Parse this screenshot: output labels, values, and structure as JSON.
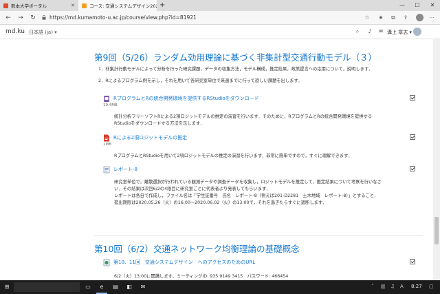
{
  "browser": {
    "tabs": [
      {
        "label": "熊本大学ポータル"
      },
      {
        "label": "コース: 交通システムデザイン2020 (..."
      }
    ],
    "new_tab": "+",
    "url": "https://md.kumamoto-u.ac.jp/course/view.php?id=81921"
  },
  "header": {
    "brand": "md.ku",
    "language": "日本語 (ja) ▾",
    "user_name": "溝上 章志 ▾"
  },
  "sections": [
    {
      "title": "第9回（5/26）ランダム効用理論に基づく非集計型交通行動モデル（３）",
      "summary": [
        "1．非集計行動モデルによって分析を行った研究課題，データの収集方法，モデル構成，推定結果，政策提言への応用について，説明します．",
        "2．Rによるプログラム例を示し，それを用いて各研究室単位で来週までに行って欲しい課題を出します．"
      ],
      "activities": [
        {
          "icon": "r-package-icon",
          "label": "RプログラムとRの統合開発環境を提供するRStudioをダウンロード",
          "size": "19.4MB",
          "desc": [
            "統計分析フリーソフトRによる2項ロジットモデルの推定の演習を行います．そのために，RプログラムとRの統合開発環境を提供する",
            "RStudioをダウンロードする方法を示します．"
          ]
        },
        {
          "icon": "pdf-icon",
          "label": "Rによる2項ロジットモデルの推定",
          "size": "1MB",
          "desc": [
            "RプログラムとRStudioを用いて2項ロジットモデルの推定の演習を行います．非常に簡単ですので，すぐに理解できます．"
          ]
        },
        {
          "icon": "assignment-icon",
          "label": "レポート-8",
          "size": "",
          "desc": [
            "研究室単位で，離散選択が行われている観測データや調査データを収集し，ロジットモデルを推定して，推定結果について考察を行いなさ",
            "い．その結果は次回6/2の4限目に研究室ごとに代表者より発表してもらいます．",
            "レポートは各自で作成し，ファイル名は「学生証番号　氏名　レポート-8（例えば201-D2281　土木地域　レポート-8）」とすること．",
            "提出期限は2020.05.26（火）の16:00～2020.06.02（火）の13:00で，それを過ぎたらすぐに遮断します．"
          ]
        }
      ]
    },
    {
      "title": "第10回（6/2）交通ネットワーク均衡理論の基礎概念",
      "summary": [],
      "activities": [
        {
          "icon": "url-icon",
          "label": "第10、11回　交通システムデザイン　へのアクセスのためのURL",
          "size": "",
          "desc": [
            "6/2（火）13:00に開講します．ミーティングID: 935 9149 3415　パスワード: 466454"
          ]
        }
      ]
    }
  ],
  "taskbar": {
    "time": "8:27"
  },
  "colors": {
    "link": "#1177d1",
    "taskbar": "#1c1c1c"
  }
}
